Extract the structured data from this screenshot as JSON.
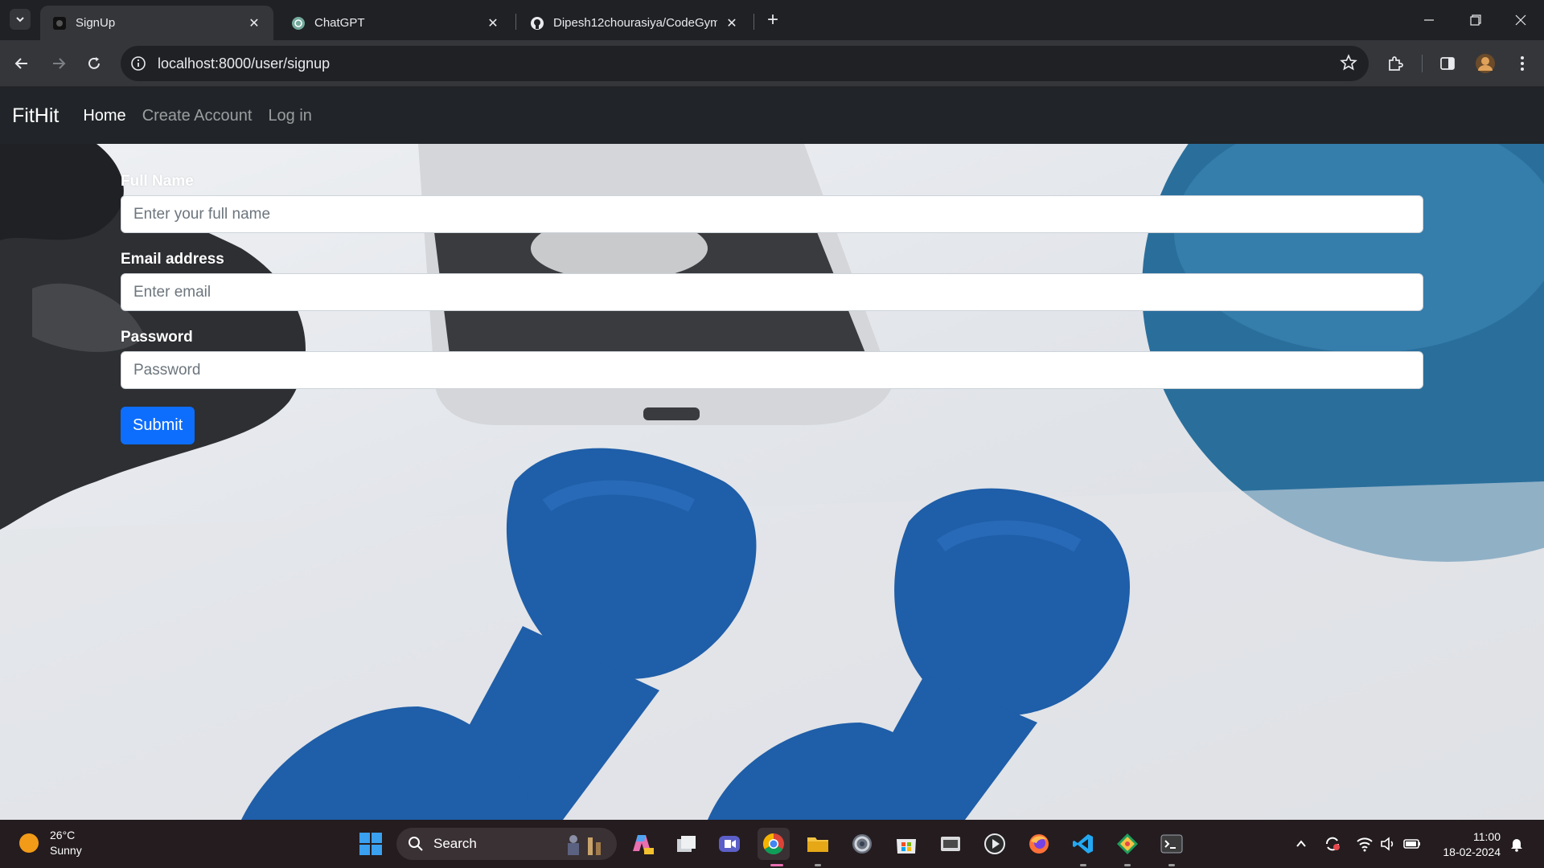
{
  "browser": {
    "tabs": [
      {
        "title": "SignUp",
        "active": true
      },
      {
        "title": "ChatGPT",
        "active": false
      },
      {
        "title": "Dipesh12chourasiya/CodeGym",
        "active": false
      }
    ],
    "url": "localhost:8000/user/signup"
  },
  "app": {
    "brand": "FitHit",
    "nav": [
      {
        "label": "Home",
        "active": true
      },
      {
        "label": "Create Account",
        "active": false
      },
      {
        "label": "Log in",
        "active": false
      }
    ],
    "form": {
      "full_name": {
        "label": "Full Name",
        "placeholder": "Enter your full name",
        "value": ""
      },
      "email": {
        "label": "Email address",
        "placeholder": "Enter email",
        "value": ""
      },
      "password": {
        "label": "Password",
        "placeholder": "Password",
        "value": ""
      },
      "submit_label": "Submit"
    }
  },
  "taskbar": {
    "weather": {
      "temp": "26°C",
      "condition": "Sunny"
    },
    "search_label": "Search",
    "time": "11:00",
    "date": "18-02-2024"
  },
  "colors": {
    "navbar_bg": "#212529",
    "primary_button": "#0d6efd",
    "dumbbell_blue": "#1f5ea8",
    "taskbar_bg": "#241c1f"
  }
}
